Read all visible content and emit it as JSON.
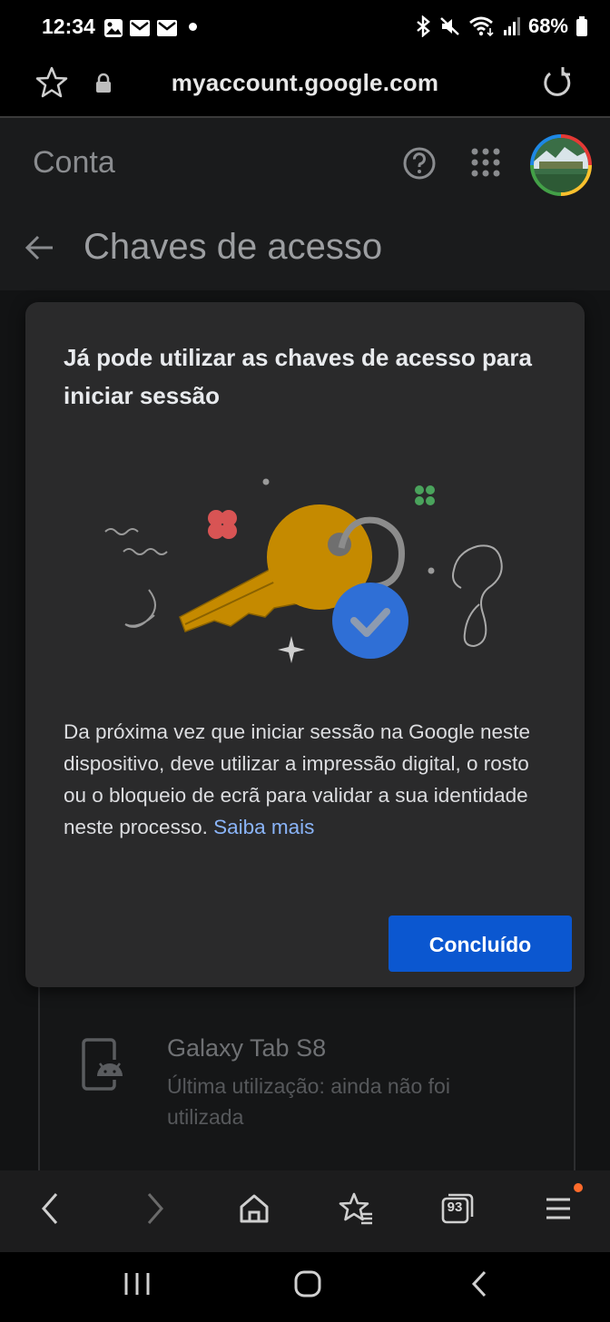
{
  "status_bar": {
    "time": "12:34",
    "battery": "68%"
  },
  "browser": {
    "url": "myaccount.google.com"
  },
  "header": {
    "account_label": "Conta",
    "page_title": "Chaves de acesso"
  },
  "dialog": {
    "heading": "Já pode utilizar as chaves de acesso para iniciar sessão",
    "body": "Da próxima vez que iniciar sessão na Google neste dispositivo, deve utilizar a impressão digi­tal, o rosto ou o bloqueio de ecrã para validar a sua identidade neste processo.",
    "learn_more": "Saiba mais",
    "done_button": "Concluído"
  },
  "passkey_device": {
    "name": "Galaxy Tab S8",
    "last_used": "Última utilização: ainda não foi utilizada"
  },
  "toolbar": {
    "tabs_count": "93"
  },
  "colors": {
    "accent": "#0b57d0",
    "link": "#8ab4f8",
    "dialog_bg": "#2a2a2b",
    "key": "#c58a00",
    "check_circle": "#2f6fd6"
  }
}
